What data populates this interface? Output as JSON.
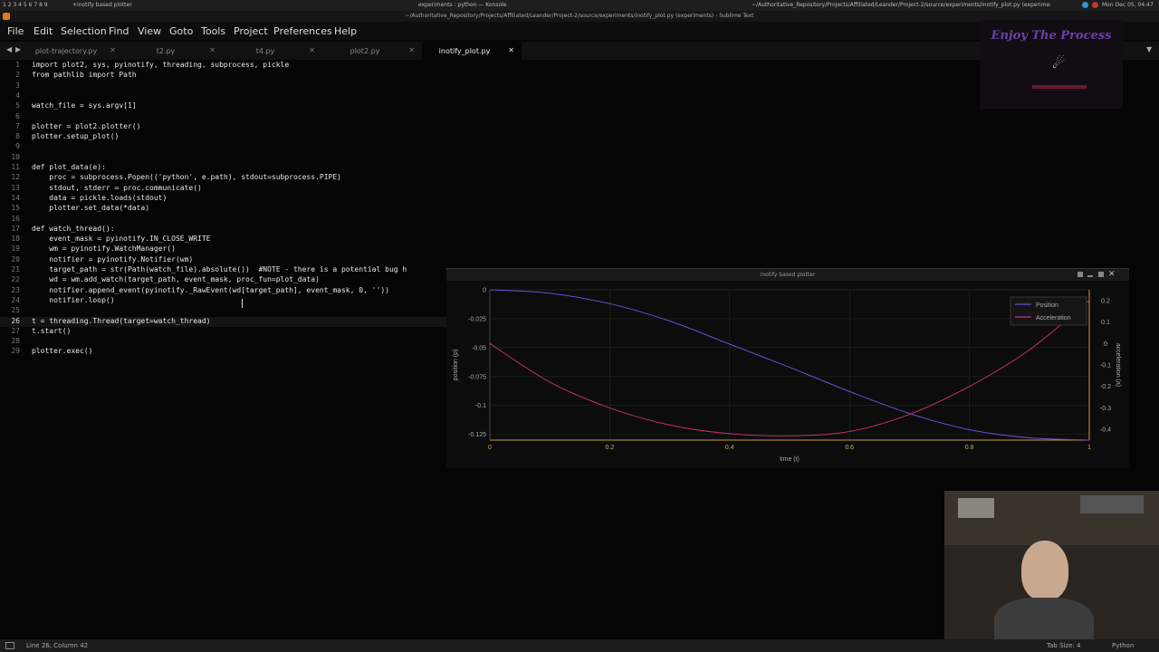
{
  "system_bar": {
    "workspaces": "1 2 3 4 5 6 7 8 9",
    "window_left": "+inotify based plotter",
    "window_mid": "experiments : python — Konsole",
    "window_right": "~/Authoritative_Repository/Projects/Affiliated/Leander/Project-2/source/experiments/inotify_plot.py (experiments) - Sublime Text",
    "clock": "Mon Dec 05, 04:47"
  },
  "title_bar": {
    "title": "~/Authoritative_Repository/Projects/Affiliated/Leander/Project-2/source/experiments/inotify_plot.py (experiments) - Sublime Text"
  },
  "menu": [
    "File",
    "Edit",
    "Selection",
    "Find",
    "View",
    "Goto",
    "Tools",
    "Project",
    "Preferences",
    "Help"
  ],
  "tabs": [
    {
      "label": "plot-trajectory.py",
      "active": false
    },
    {
      "label": "t2.py",
      "active": false
    },
    {
      "label": "t4.py",
      "active": false
    },
    {
      "label": "plot2.py",
      "active": false
    },
    {
      "label": "inotify_plot.py",
      "active": true
    }
  ],
  "code": [
    {
      "n": "1",
      "t": "import plot2, sys, pyinotify, threading, subprocess, pickle"
    },
    {
      "n": "2",
      "t": "from pathlib import Path"
    },
    {
      "n": "3",
      "t": ""
    },
    {
      "n": "4",
      "t": ""
    },
    {
      "n": "5",
      "t": "watch_file = sys.argv[1]"
    },
    {
      "n": "6",
      "t": ""
    },
    {
      "n": "7",
      "t": "plotter = plot2.plotter()"
    },
    {
      "n": "8",
      "t": "plotter.setup_plot()"
    },
    {
      "n": "9",
      "t": ""
    },
    {
      "n": "10",
      "t": ""
    },
    {
      "n": "11",
      "t": "def plot_data(e):"
    },
    {
      "n": "12",
      "t": "    proc = subprocess.Popen(('python', e.path), stdout=subprocess.PIPE)"
    },
    {
      "n": "13",
      "t": "    stdout, stderr = proc.communicate()"
    },
    {
      "n": "14",
      "t": "    data = pickle.loads(stdout)"
    },
    {
      "n": "15",
      "t": "    plotter.set_data(*data)"
    },
    {
      "n": "16",
      "t": ""
    },
    {
      "n": "17",
      "t": "def watch_thread():"
    },
    {
      "n": "18",
      "t": "    event_mask = pyinotify.IN_CLOSE_WRITE"
    },
    {
      "n": "19",
      "t": "    wm = pyinotify.WatchManager()"
    },
    {
      "n": "20",
      "t": "    notifier = pyinotify.Notifier(wm)"
    },
    {
      "n": "21",
      "t": "    target_path = str(Path(watch_file).absolute())  #NOTE - there is a potential bug h"
    },
    {
      "n": "22",
      "t": "    wd = wm.add_watch(target_path, event_mask, proc_fun=plot_data)"
    },
    {
      "n": "23",
      "t": "    notifier.append_event(pyinotify._RawEvent(wd[target_path], event_mask, 0, ''))"
    },
    {
      "n": "24",
      "t": "    notifier.loop()"
    },
    {
      "n": "25",
      "t": ""
    },
    {
      "n": "26",
      "t": "t = threading.Thread(target=watch_thread)"
    },
    {
      "n": "27",
      "t": "t.start()"
    },
    {
      "n": "28",
      "t": ""
    },
    {
      "n": "29",
      "t": "plotter.exec()"
    }
  ],
  "plot_window": {
    "title": "inotify based plotter"
  },
  "chart_data": {
    "type": "line",
    "title": "",
    "xlabel": "time (t)",
    "ylabel_left": "position (p)",
    "ylabel_right": "acceleration (a)",
    "xlim": [
      0,
      1
    ],
    "ylim_left": [
      -0.13,
      0
    ],
    "ylim_right": [
      -0.45,
      0.25
    ],
    "x_ticks": [
      "0",
      "0.2",
      "0.4",
      "0.6",
      "0.8",
      "1"
    ],
    "y_ticks_left": [
      "0",
      "-0.025",
      "-0.05",
      "-0.075",
      "-0.1",
      "-0.125"
    ],
    "y_ticks_right": [
      "0.2",
      "0.1",
      "0",
      "-0.1",
      "-0.2",
      "-0.3",
      "-0.4"
    ],
    "grid": true,
    "legend_position": "top-right",
    "x": [
      0,
      0.1,
      0.2,
      0.3,
      0.4,
      0.5,
      0.6,
      0.7,
      0.8,
      0.9,
      1.0
    ],
    "series": [
      {
        "name": "Position",
        "axis": "left",
        "color": "#6a4fd8",
        "values": [
          0,
          -0.003,
          -0.012,
          -0.027,
          -0.047,
          -0.067,
          -0.088,
          -0.107,
          -0.121,
          -0.128,
          -0.13
        ]
      },
      {
        "name": "Acceleration",
        "axis": "right",
        "color": "#c2306a",
        "values": [
          0.0,
          -0.18,
          -0.3,
          -0.38,
          -0.42,
          -0.43,
          -0.41,
          -0.33,
          -0.2,
          -0.03,
          0.2
        ]
      }
    ]
  },
  "logo": {
    "text": "Enjoy The Process"
  },
  "status_bar": {
    "position": "Line 26, Column 42",
    "tab_size": "Tab Size: 4",
    "syntax": "Python"
  },
  "colors": {
    "keyword": "#e8e8e8",
    "function": "#4a88c7",
    "param": "#d08a3a",
    "constant": "#4a88c7",
    "comment": "#555555"
  }
}
